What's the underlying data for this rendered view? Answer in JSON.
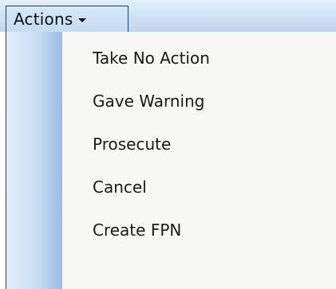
{
  "menu_button": {
    "label": "Actions"
  },
  "menu": {
    "items": [
      {
        "label": "Take No Action"
      },
      {
        "label": "Gave Warning"
      },
      {
        "label": "Prosecute"
      },
      {
        "label": "Cancel"
      },
      {
        "label": "Create FPN"
      }
    ]
  },
  "icons": {
    "dropdown": "chevron-down-icon"
  },
  "colors": {
    "toolbar_light": "#e4f0fb",
    "toolbar_dark": "#bed6f0",
    "border": "#1c3f74",
    "menu_bg": "#f7f7f5",
    "gutter_dark": "#9bbbe4"
  }
}
